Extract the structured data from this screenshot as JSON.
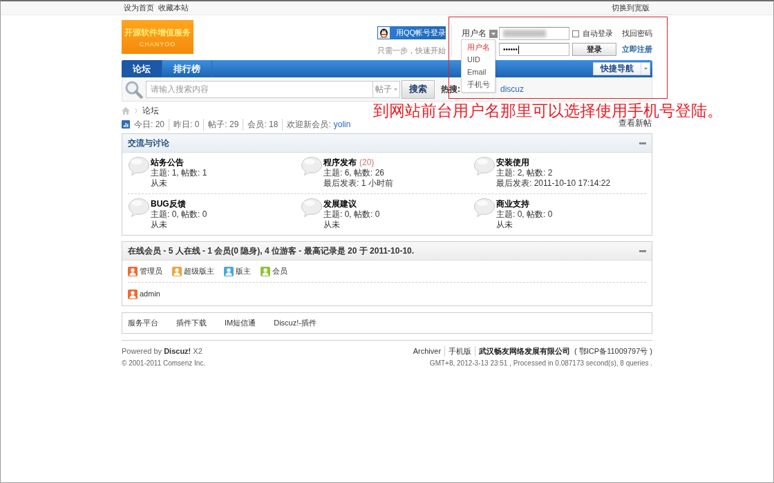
{
  "top_bar": {
    "left_links": [
      "设为首页",
      "收藏本站"
    ],
    "right_link": "切换到宽版"
  },
  "header": {
    "logo": {
      "title": "开源软件增值服务",
      "subtitle": "CHANYOO"
    },
    "qq_login": {
      "button": "用QQ帐号登录",
      "hint": "只需一步，快速开始"
    },
    "login": {
      "id_type": "用户名",
      "username": {
        "redacted": true
      },
      "password": {
        "value": "••••••"
      },
      "remember": {
        "label": "自动登录",
        "checked": false
      },
      "submit": "登录",
      "links": [
        {
          "label": "找回密码",
          "kind": "plain"
        },
        {
          "label": "立即注册",
          "kind": "strong"
        }
      ],
      "id_type_menu": {
        "expanded": true,
        "items": [
          {
            "label": "用户名",
            "selected": true
          },
          {
            "label": "UID",
            "selected": false
          },
          {
            "label": "Email",
            "selected": false
          },
          {
            "label": "手机号",
            "selected": false
          }
        ]
      }
    }
  },
  "nav": {
    "tabs": [
      {
        "label": "论坛",
        "selected": true
      },
      {
        "label": "排行榜",
        "selected": false
      }
    ],
    "quick_nav": "快捷导航"
  },
  "search": {
    "placeholder": "请输入搜索内容",
    "scope": "帖子",
    "button": "搜索",
    "hot_label": "热搜:",
    "hot_terms": [
      "discuz"
    ]
  },
  "breadcrumb": [
    "论坛"
  ],
  "stats": {
    "items": [
      "今日: 20",
      "昨日: 0",
      "帖子: 29",
      "会员: 18"
    ],
    "welcome": "欢迎新会员:",
    "new_member": "yolin",
    "new_posts": "查看新帖"
  },
  "forum_group": {
    "title": "交流与讨论",
    "expanded": true,
    "forums": [
      {
        "name": "站务公告",
        "stats": "主题: 1, 帖数: 1",
        "last_post": "从未"
      },
      {
        "name": "程序发布",
        "today": "(20)",
        "stats": "主题: 6, 帖数: 26",
        "last_post": "最后发表: 1 小时前"
      },
      {
        "name": "安装使用",
        "stats": "主题: 2, 帖数: 2",
        "last_post": "最后发表: 2011-10-10 17:14:22"
      },
      {
        "name": "BUG反馈",
        "stats": "主题: 0, 帖数: 0",
        "last_post": "从未"
      },
      {
        "name": "发展建议",
        "stats": "主题: 0, 帖数: 0",
        "last_post": "从未"
      },
      {
        "name": "商业支持",
        "stats": "主题: 0, 帖数: 0",
        "last_post": "从未"
      }
    ]
  },
  "online": {
    "title": "在线会员 - 5 人在线 - 1 会员(0 隐身), 4 位游客 - 最高记录是 20 于 2011-10-10.",
    "expanded": true,
    "legend": [
      {
        "label": "管理员",
        "color": "#ee6b2f"
      },
      {
        "label": "超级版主",
        "color": "#eea43c"
      },
      {
        "label": "版主",
        "color": "#4aa8dc"
      },
      {
        "label": "会员",
        "color": "#8dc23a"
      }
    ],
    "members": [
      {
        "name": "admin",
        "color": "#ee6b2f"
      }
    ]
  },
  "links": [
    "服务平台",
    "插件下载",
    "IM短信通",
    "Discuz!-插件"
  ],
  "footer": {
    "powered": "Powered by **Discuz!** X2",
    "copyright": "© 2001-2011 Comsenz Inc.",
    "links": [
      "Archiver",
      "手机版"
    ],
    "company": "武汉畅友网络发展有限公司",
    "icp": "( 鄂ICP备11009797号 )",
    "processed": "GMT+8, 2012-3-13 23:51 , Processed in 0.087173 second(s), 8 queries ."
  },
  "annotation": {
    "highlight": true,
    "note": "到网站前台用户名那里可以选择使用手机号登陆。"
  }
}
